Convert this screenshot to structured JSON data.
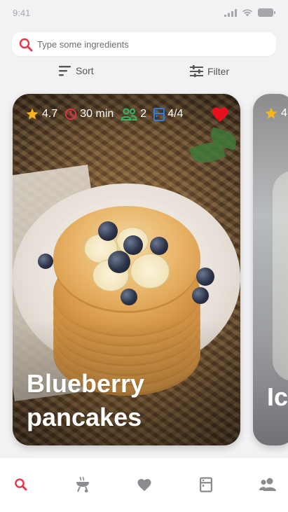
{
  "status": {
    "time": "9:41"
  },
  "search": {
    "placeholder": "Type some ingredients",
    "value": ""
  },
  "toolbar": {
    "sort_label": "Sort",
    "filter_label": "Filter"
  },
  "cards": [
    {
      "title_line1": "Blueberry",
      "title_line2": "pancakes",
      "rating": "4.7",
      "time": "30 min",
      "servings": "2",
      "ingredients": "4/4",
      "favorited": true
    },
    {
      "title_line1": "Ic",
      "rating": "4"
    }
  ],
  "colors": {
    "accent": "#e8344a",
    "star": "#f5b51f",
    "clock": "#e8344a",
    "people": "#2fb86a",
    "ingredients": "#2f7de0",
    "heart": "#e8101f",
    "tab_inactive": "#8b8b90"
  },
  "tabbar": {
    "items": [
      {
        "icon": "search-icon",
        "active": true
      },
      {
        "icon": "grill-icon",
        "active": false
      },
      {
        "icon": "heart-icon",
        "active": false
      },
      {
        "icon": "fridge-icon",
        "active": false
      },
      {
        "icon": "people-icon",
        "active": false
      }
    ]
  }
}
